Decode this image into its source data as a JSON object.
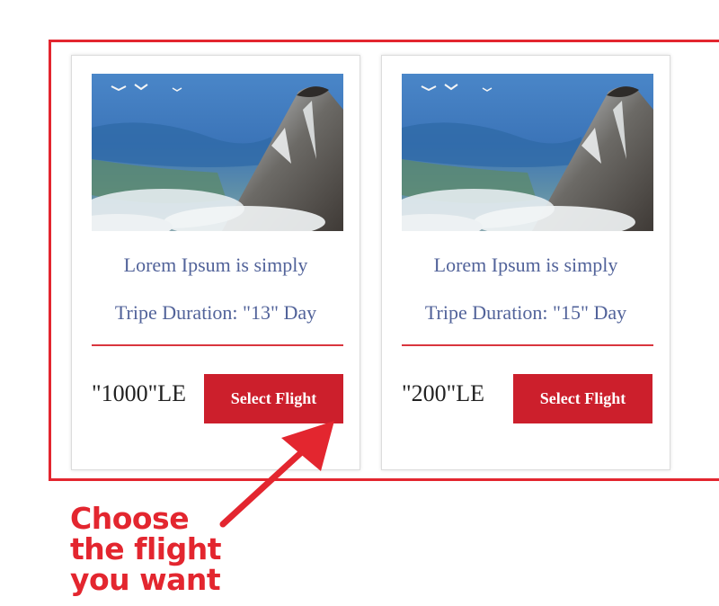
{
  "cards": [
    {
      "title": "Lorem Ipsum is simply",
      "duration": "Tripe Duration: \"13\" Day",
      "price": "\"1000\"LE",
      "button_label": "Select Flight"
    },
    {
      "title": "Lorem Ipsum is simply",
      "duration": "Tripe Duration: \"15\" Day",
      "price": "\"200\"LE",
      "button_label": "Select Flight"
    }
  ],
  "callout": {
    "lines": [
      "Choose",
      "the flight",
      "you want"
    ]
  },
  "colors": {
    "accent": "#e3262f",
    "button": "#cc1f2c",
    "text_muted": "#52639a"
  },
  "icons": {
    "card_image": "volcano-landscape-image",
    "annotation_arrow": "arrow-icon"
  }
}
